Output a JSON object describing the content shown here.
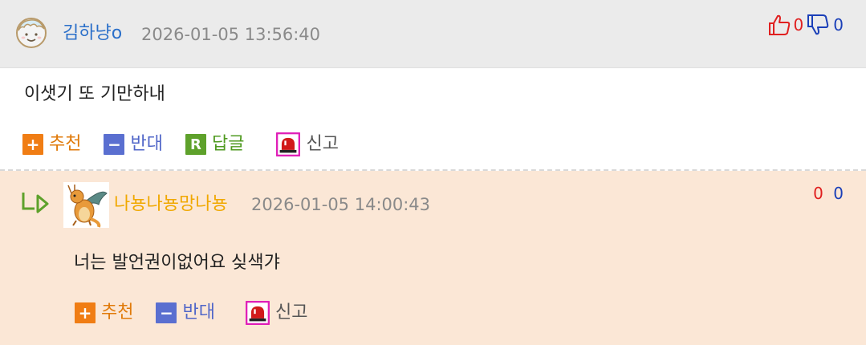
{
  "comment": {
    "avatar_icon": "smiley-face-icon",
    "username": "김하냥o",
    "timestamp": "2026-01-05 13:56:40",
    "upvotes": "0",
    "downvotes": "0",
    "body": "이샛기 또 기만하내",
    "actions": {
      "recommend": {
        "icon": "+",
        "label": "추천"
      },
      "oppose": {
        "icon": "−",
        "label": "반대"
      },
      "reply": {
        "icon": "R",
        "label": "답글"
      },
      "report": {
        "label": "신고"
      }
    }
  },
  "reply": {
    "username": "나뇽나뇽망나뇽",
    "timestamp": "2026-01-05 14:00:43",
    "upvotes": "0",
    "downvotes": "0",
    "body": "너는 발언권이없어요 싲색갸",
    "actions": {
      "recommend": {
        "icon": "+",
        "label": "추천"
      },
      "oppose": {
        "icon": "−",
        "label": "반대"
      },
      "report": {
        "label": "신고"
      }
    }
  },
  "colors": {
    "username_main": "#2a6fc9",
    "username_reply": "#f0a800",
    "upvote": "#e02020",
    "downvote": "#1a3fb8",
    "reply_bg": "#fbe7d6",
    "header_bg": "#ebebeb"
  }
}
